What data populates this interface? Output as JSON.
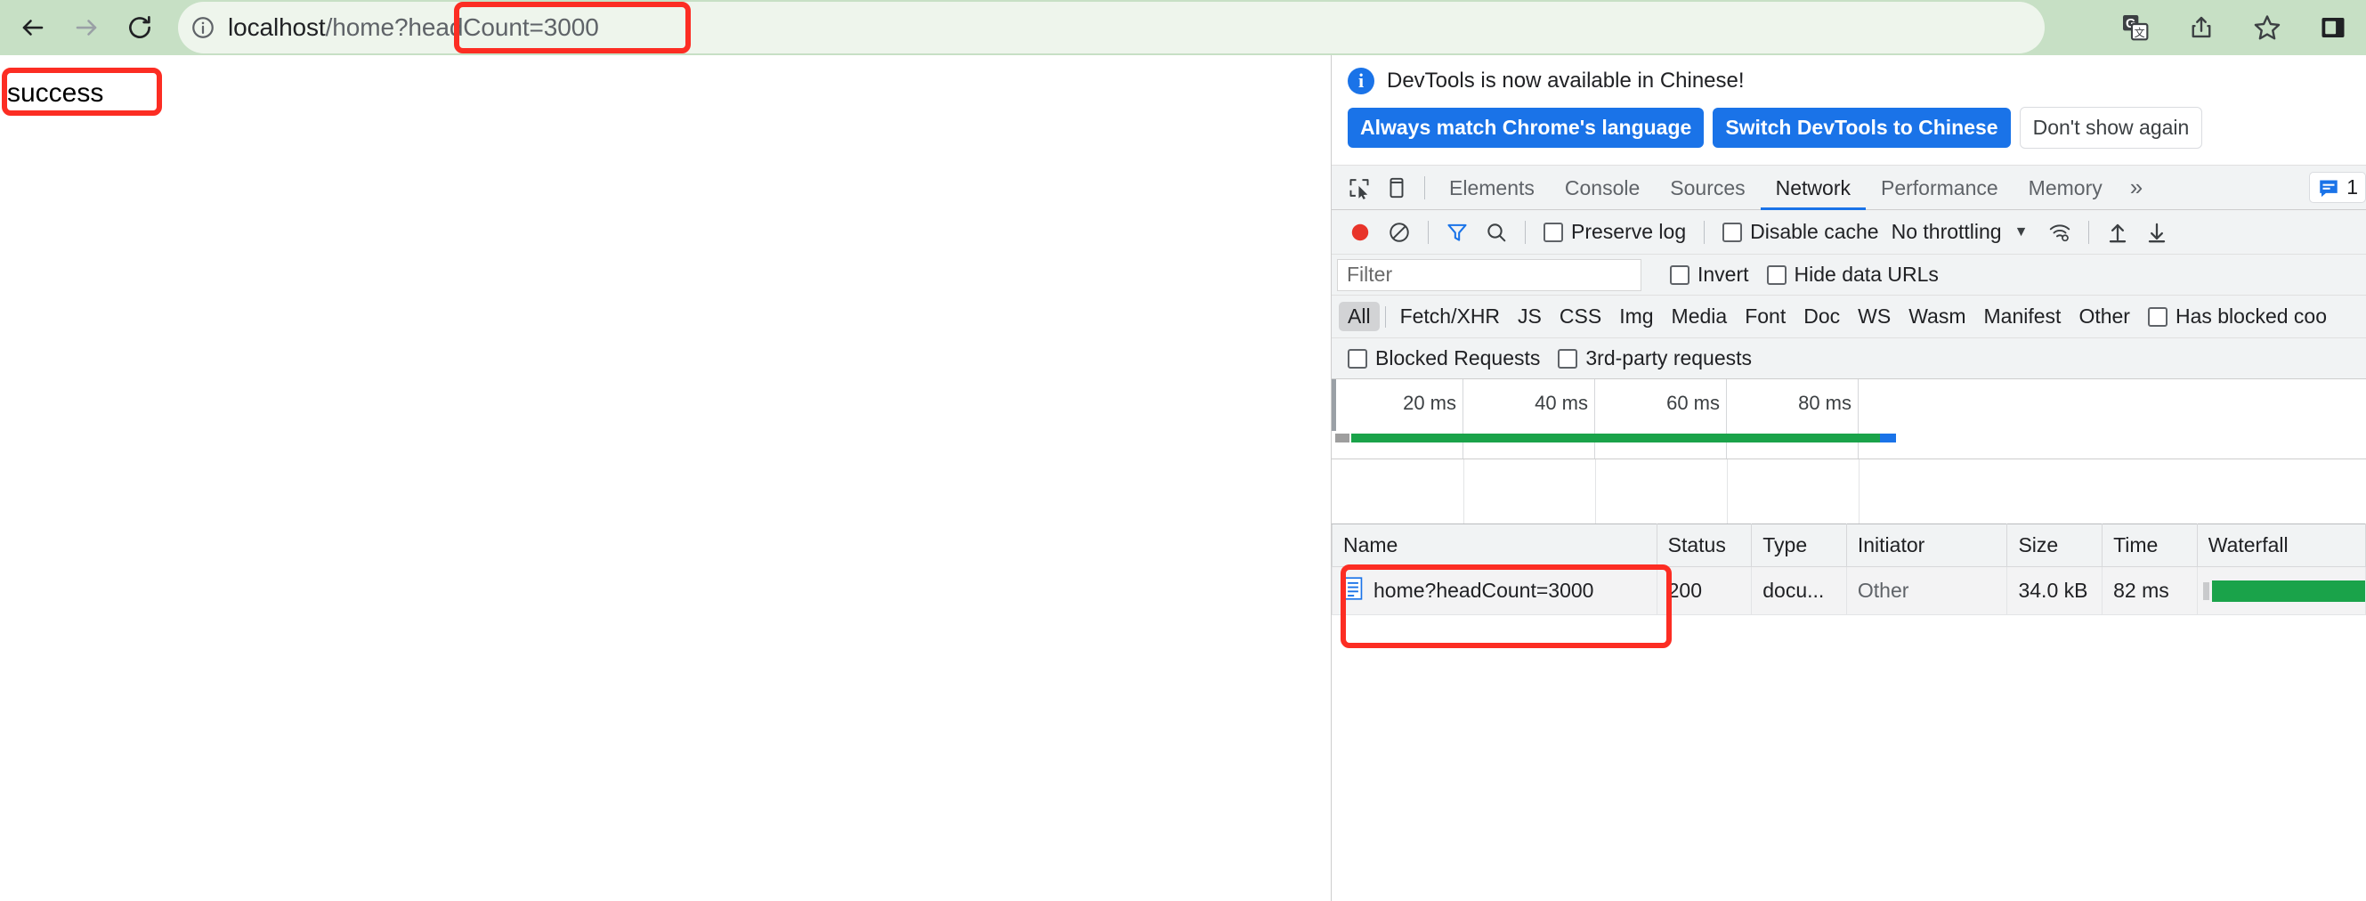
{
  "browser": {
    "nav": {
      "back_label": "Back",
      "forward_label": "Forward",
      "reload_label": "Reload"
    },
    "omnibox": {
      "info_icon": "info-circle-icon",
      "url_host": "localhost",
      "url_path": "/home?headCount=3000",
      "full_url": "localhost/home?headCount=3000"
    },
    "toolbar_icons": [
      {
        "name": "translate-icon",
        "label": "Translate this page"
      },
      {
        "name": "share-icon",
        "label": "Share this page"
      },
      {
        "name": "bookmark-star-icon",
        "label": "Bookmark this tab"
      },
      {
        "name": "side-panel-icon",
        "label": "Show side panel"
      }
    ]
  },
  "page": {
    "body_text": "success"
  },
  "devtools": {
    "banner": {
      "info_icon": "info-icon",
      "message": "DevTools is now available in Chinese!",
      "buttons": [
        {
          "label": "Always match Chrome's language",
          "style": "primary"
        },
        {
          "label": "Switch DevTools to Chinese",
          "style": "primary"
        },
        {
          "label": "Don't show again",
          "style": "plain"
        }
      ]
    },
    "tabbar": {
      "inspect_icon": "inspect-element-icon",
      "device_icon": "device-toolbar-icon",
      "tabs": [
        {
          "label": "Elements",
          "active": false
        },
        {
          "label": "Console",
          "active": false
        },
        {
          "label": "Sources",
          "active": false
        },
        {
          "label": "Network",
          "active": true
        },
        {
          "label": "Performance",
          "active": false
        },
        {
          "label": "Memory",
          "active": false
        }
      ],
      "overflow_label": "»",
      "message_icon": "message-bubble-icon",
      "message_count": "1"
    },
    "network_toolbar": {
      "record_icon": "record-stop-icon",
      "clear_icon": "clear-icon",
      "filter_icon": "funnel-filter-icon",
      "search_icon": "search-icon",
      "preserve_log_label": "Preserve log",
      "preserve_log_checked": false,
      "disable_cache_label": "Disable cache",
      "disable_cache_checked": false,
      "throttling_value": "No throttling",
      "throttling_caret": "▼",
      "network_conditions_icon": "wifi-settings-icon",
      "import_icon": "upload-arrow-icon",
      "export_icon": "download-arrow-icon"
    },
    "filter_row": {
      "filter_placeholder": "Filter",
      "filter_value": "",
      "invert_label": "Invert",
      "invert_checked": false,
      "hide_data_urls_label": "Hide data URLs",
      "hide_data_urls_checked": false
    },
    "type_filters": {
      "chips": [
        {
          "label": "All",
          "active": true
        },
        {
          "label": "Fetch/XHR",
          "active": false
        },
        {
          "label": "JS",
          "active": false
        },
        {
          "label": "CSS",
          "active": false
        },
        {
          "label": "Img",
          "active": false
        },
        {
          "label": "Media",
          "active": false
        },
        {
          "label": "Font",
          "active": false
        },
        {
          "label": "Doc",
          "active": false
        },
        {
          "label": "WS",
          "active": false
        },
        {
          "label": "Wasm",
          "active": false
        },
        {
          "label": "Manifest",
          "active": false
        },
        {
          "label": "Other",
          "active": false
        }
      ],
      "has_blocked_cookies_label": "Has blocked coo",
      "has_blocked_cookies_checked": false
    },
    "blocked_row": {
      "blocked_requests_label": "Blocked Requests",
      "blocked_requests_checked": false,
      "third_party_label": "3rd-party requests",
      "third_party_checked": false
    },
    "overview": {
      "ticks": [
        "20 ms",
        "40 ms",
        "60 ms",
        "80 ms"
      ]
    },
    "requests_table": {
      "columns": [
        "Name",
        "Status",
        "Type",
        "Initiator",
        "Size",
        "Time",
        "Waterfall"
      ],
      "rows": [
        {
          "icon": "document-file-icon",
          "name": "home?headCount=3000",
          "status": "200",
          "type": "docu...",
          "initiator": "Other",
          "size": "34.0 kB",
          "time": "82 ms"
        }
      ]
    }
  },
  "annotations": {
    "url_highlight": "headCount=3000",
    "success_highlight": "success",
    "request_row_highlight": "home?headCount=3000",
    "color": "#fc2d23"
  }
}
